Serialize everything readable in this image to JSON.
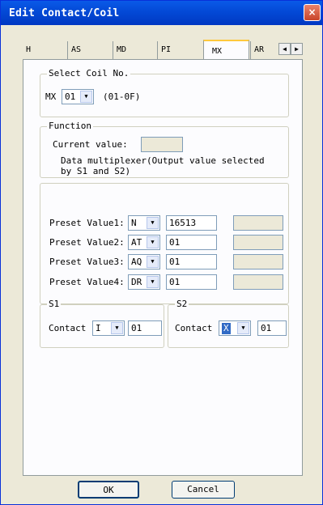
{
  "window": {
    "title": "Edit Contact/Coil",
    "close_glyph": "×"
  },
  "tabs": [
    {
      "label": "H"
    },
    {
      "label": "AS"
    },
    {
      "label": "MD"
    },
    {
      "label": "PI"
    },
    {
      "label": "MX"
    },
    {
      "label": "AR"
    }
  ],
  "tab_scroll": {
    "left": "◀",
    "right": "▶"
  },
  "select_coil": {
    "legend": "Select Coil No.",
    "prefix": "MX",
    "value": "01",
    "range": "(01-0F)"
  },
  "function": {
    "legend": "Function",
    "current_value_label": "Current value:",
    "current_value": "",
    "description_line1": "Data multiplexer(Output value selected",
    "description_line2": "by S1 and S2)"
  },
  "presets": [
    {
      "label": "Preset Value1:",
      "type": "N",
      "value": "16513",
      "readout": ""
    },
    {
      "label": "Preset Value2:",
      "type": "AT",
      "value": "01",
      "readout": ""
    },
    {
      "label": "Preset Value3:",
      "type": "AQ",
      "value": "01",
      "readout": ""
    },
    {
      "label": "Preset Value4:",
      "type": "DR",
      "value": "01",
      "readout": ""
    }
  ],
  "s1": {
    "legend": "S1",
    "contact_label": "Contact",
    "type": "I",
    "value": "01"
  },
  "s2": {
    "legend": "S2",
    "contact_label": "Contact",
    "type": "X",
    "value": "01"
  },
  "buttons": {
    "ok": "OK",
    "cancel": "Cancel"
  },
  "colors": {
    "title_bar": "#0349d6",
    "selection": "#316ac5",
    "dialog": "#ece9d8"
  }
}
